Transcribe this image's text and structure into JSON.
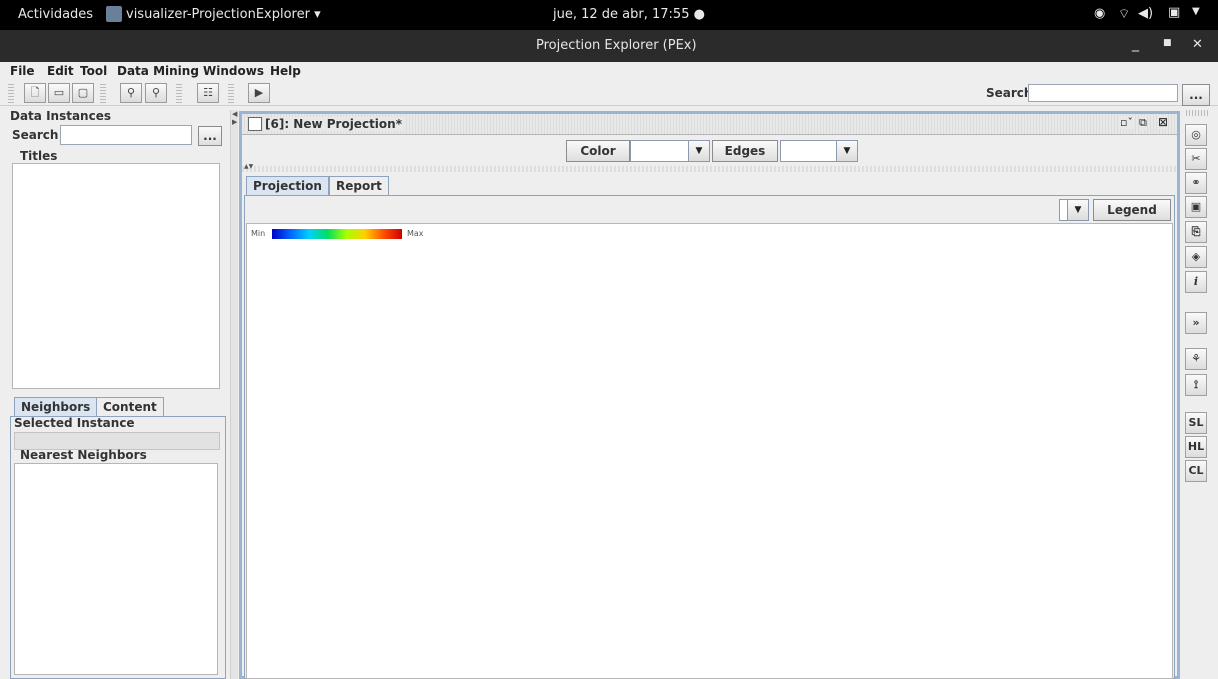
{
  "topbar": {
    "activities": "Actividades",
    "app_name": "visualizer-ProjectionExplorer ▾",
    "clock": "jue, 12 de abr, 17:55 ●"
  },
  "window": {
    "title": "Projection Explorer (PEx)"
  },
  "menu": {
    "items": [
      "File",
      "Edit",
      "Tool",
      "Data Mining",
      "Windows",
      "Help"
    ]
  },
  "toolbar": {
    "search_label": "Search",
    "search_value": "",
    "more_label": "..."
  },
  "left": {
    "data_instances_title": "Data Instances",
    "search_label": "Search",
    "search_value": "",
    "more_label": "...",
    "titles_label": "Titles",
    "tabs": [
      "Neighbors",
      "Content"
    ],
    "selected_instance_label": "Selected Instance",
    "nearest_neighbors_label": "Nearest Neighbors"
  },
  "internal_frame": {
    "title": "[6]: New Projection*",
    "color_label": "Color",
    "edges_label": "Edges",
    "tabs": [
      "Projection",
      "Report"
    ],
    "legend_label": "Legend",
    "scale_min": "Min",
    "scale_max": "Max"
  },
  "right_toolbar": {
    "sl": "SL",
    "hl": "HL",
    "cl": "CL"
  }
}
